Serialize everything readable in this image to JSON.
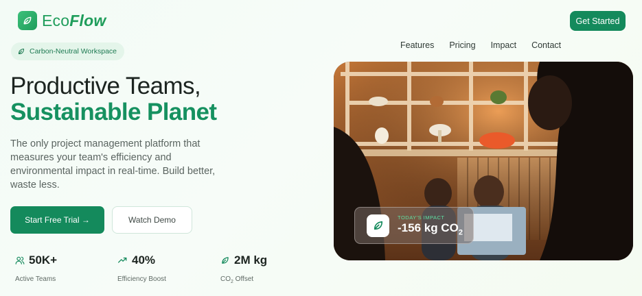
{
  "brand": {
    "name_part1": "Eco",
    "name_part2": "Flow",
    "icon": "leaf-icon"
  },
  "header": {
    "cta_label": "Get Started"
  },
  "nav": {
    "items": [
      "Features",
      "Pricing",
      "Impact",
      "Contact"
    ]
  },
  "badge": {
    "label": "Carbon-Neutral Workspace",
    "icon": "leaf-icon"
  },
  "hero_text": {
    "title_line1": "Productive Teams,",
    "title_line2": "Sustainable Planet",
    "subtitle": "The only project management platform that measures your team's efficiency and environmental impact in real-time. Build better, waste less."
  },
  "buttons": {
    "primary": "Start Free Trial →",
    "secondary": "Watch Demo"
  },
  "stats": [
    {
      "icon": "users-icon",
      "value": "50K+",
      "label": "Active Teams"
    },
    {
      "icon": "trending-up-icon",
      "value": "40%",
      "label": "Efficiency Boost"
    },
    {
      "icon": "leaf-icon",
      "value": "2M kg",
      "label_prefix": "CO",
      "label_sub": "2",
      "label_suffix": " Offset"
    }
  ],
  "impact_card": {
    "caption": "TODAY'S IMPACT",
    "value_prefix": "-156 kg CO",
    "value_sub": "2",
    "icon": "leaf-icon"
  },
  "colors": {
    "accent": "#148a5c",
    "accent_text": "#169160",
    "badge_bg": "#e4f5ea"
  }
}
